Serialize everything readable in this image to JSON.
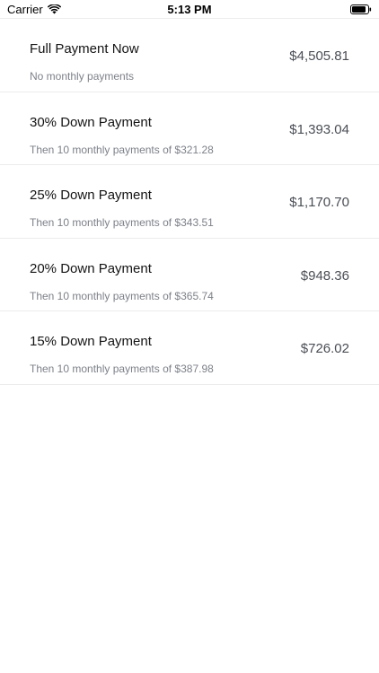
{
  "status_bar": {
    "carrier": "Carrier",
    "time": "5:13 PM"
  },
  "plans": [
    {
      "title": "Full Payment Now",
      "subtitle": "No monthly payments",
      "amount": "$4,505.81"
    },
    {
      "title": "30% Down Payment",
      "subtitle": "Then 10 monthly payments of $321.28",
      "amount": "$1,393.04"
    },
    {
      "title": "25% Down Payment",
      "subtitle": "Then 10 monthly payments of $343.51",
      "amount": "$1,170.70"
    },
    {
      "title": "20% Down Payment",
      "subtitle": "Then 10 monthly payments of $365.74",
      "amount": "$948.36"
    },
    {
      "title": "15% Down Payment",
      "subtitle": "Then 10 monthly payments of $387.98",
      "amount": "$726.02"
    }
  ]
}
